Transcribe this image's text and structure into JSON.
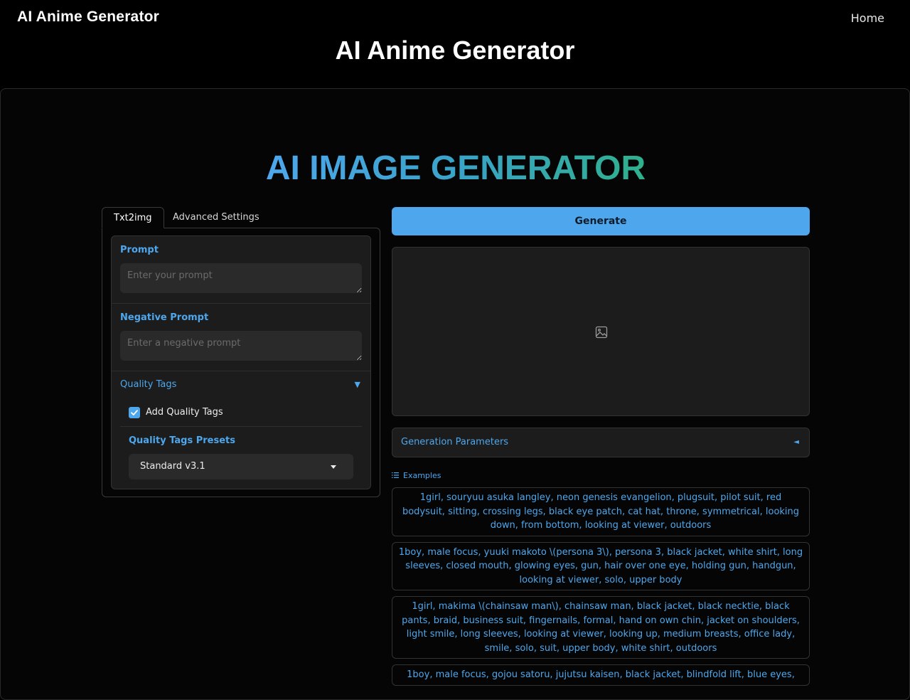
{
  "nav": {
    "brand": "AI Anime Generator",
    "home_label": "Home"
  },
  "page_title": "AI Anime Generator",
  "hero_title": "AI IMAGE GENERATOR",
  "colors": {
    "accent": "#4ea7ec",
    "gradient_start": "#4ea7ec",
    "gradient_end": "#2fb08c",
    "panel_bg": "#1c1c1c",
    "page_bg": "#000000"
  },
  "tabs": [
    {
      "label": "Txt2img",
      "active": true
    },
    {
      "label": "Advanced Settings",
      "active": false
    }
  ],
  "settings": {
    "prompt_label": "Prompt",
    "prompt_placeholder": "Enter your prompt",
    "prompt_value": "",
    "negative_label": "Negative Prompt",
    "negative_placeholder": "Enter a negative prompt",
    "negative_value": "",
    "quality_tags_label": "Quality Tags",
    "quality_tags_arrow": "▼",
    "add_quality_tags_label": "Add Quality Tags",
    "add_quality_tags_checked": true,
    "presets_label": "Quality Tags Presets",
    "presets_selected": "Standard v3.1"
  },
  "output": {
    "generate_label": "Generate",
    "image_placeholder_icon": "image-icon",
    "gen_params_label": "Generation Parameters",
    "gen_params_arrow": "◄",
    "examples_label": "Examples"
  },
  "examples": [
    "1girl, souryuu asuka langley, neon genesis evangelion, plugsuit, pilot suit, red bodysuit, sitting, crossing legs, black eye patch, cat hat, throne, symmetrical, looking down, from bottom, looking at viewer, outdoors",
    "1boy, male focus, yuuki makoto \\(persona 3\\), persona 3, black jacket, white shirt, long sleeves, closed mouth, glowing eyes, gun, hair over one eye, holding gun, handgun, looking at viewer, solo, upper body",
    "1girl, makima \\(chainsaw man\\), chainsaw man, black jacket, black necktie, black pants, braid, business suit, fingernails, formal, hand on own chin, jacket on shoulders, light smile, long sleeves, looking at viewer, looking up, medium breasts, office lady, smile, solo, suit, upper body, white shirt, outdoors",
    "1boy, male focus, gojou satoru, jujutsu kaisen, black jacket, blindfold lift, blue eyes,"
  ]
}
